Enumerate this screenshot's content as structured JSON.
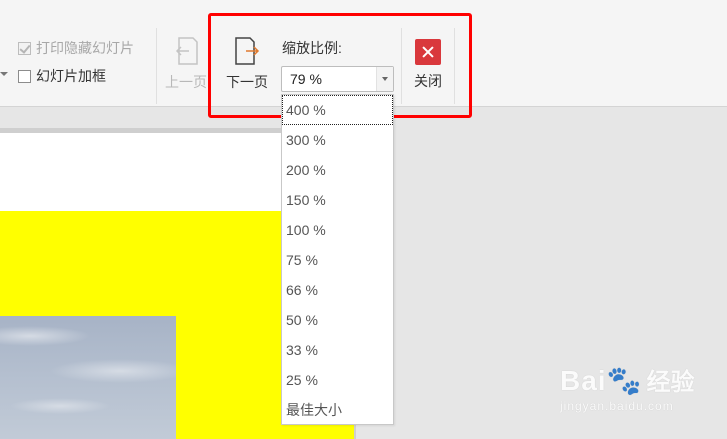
{
  "toolbar": {
    "print_hidden_label": "打印隐藏幻灯片",
    "frame_label": "幻灯片加框",
    "prev_label": "上一页",
    "next_label": "下一页",
    "zoom_label": "缩放比例:",
    "zoom_value": "79 %",
    "close_label": "关闭",
    "print_hidden_checked": true,
    "frame_checked": false
  },
  "zoom_options": [
    "400 %",
    "300 %",
    "200 %",
    "150 %",
    "100 %",
    "75 %",
    "66 %",
    "50 %",
    "33 %",
    "25 %",
    "最佳大小"
  ],
  "watermark": {
    "brand": "Bai",
    "brand2": "经验",
    "url": "jingyan.baidu.com"
  },
  "colors": {
    "highlight": "#ff0000",
    "close_button": "#d9383c",
    "slide_fill": "#ffff00"
  }
}
